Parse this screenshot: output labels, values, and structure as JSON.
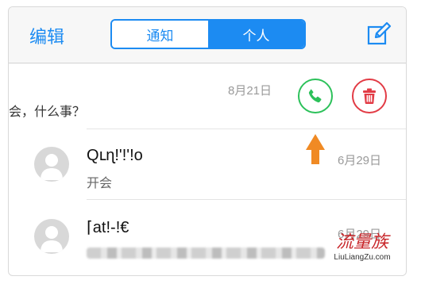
{
  "navbar": {
    "edit_label": "编辑",
    "segments": [
      {
        "label": "通知",
        "selected": false
      },
      {
        "label": "个人",
        "selected": true
      }
    ],
    "compose_icon": "compose-icon"
  },
  "rows": [
    {
      "message": "会，什么事？",
      "date": "8月21日",
      "actions": [
        "phone-icon",
        "trash-icon"
      ]
    },
    {
      "name": "Qւɳ!'!'!o",
      "message": "开会",
      "date": "6月29日"
    },
    {
      "name": "⌈at!-!€",
      "message": "",
      "date": "6月29日"
    }
  ],
  "watermark": {
    "top": "流量族",
    "bottom": "LiuLiangZu.com"
  },
  "colors": {
    "accent": "#1c8bf2",
    "call": "#2cc15a",
    "delete": "#e23b45",
    "arrow": "#f08a24"
  }
}
